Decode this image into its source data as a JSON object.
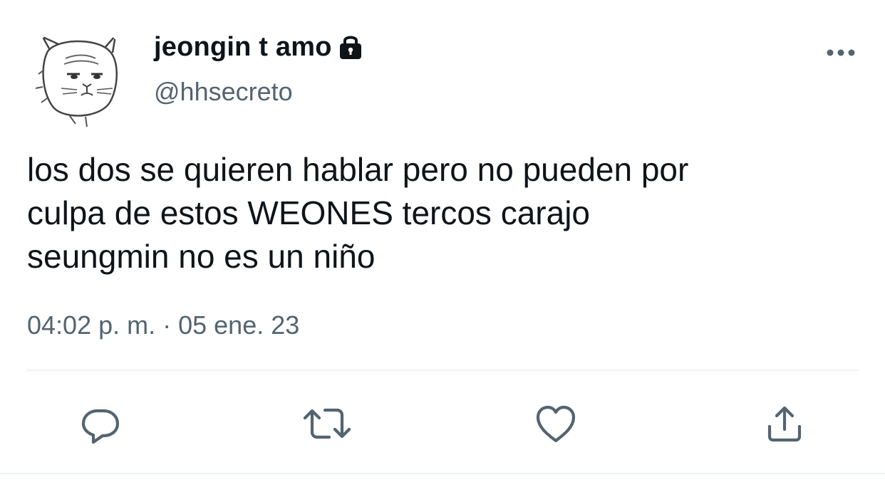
{
  "author": {
    "display_name": "jeongin t amo",
    "handle": "@hhsecreto",
    "protected_icon": "lock-icon",
    "avatar_icon": "cartoon-face-avatar"
  },
  "tweet": {
    "text": "los dos se quieren hablar pero no pueden por\nculpa de estos WEONES tercos carajo\nseungmin no es un niño",
    "time": "04:02 p. m.",
    "separator": " · ",
    "date": "05 ene. 23"
  },
  "header": {
    "more_icon": "more-horizontal-icon"
  },
  "actions": [
    {
      "name": "reply",
      "icon": "reply-bubble-icon"
    },
    {
      "name": "retweet",
      "icon": "retweet-icon"
    },
    {
      "name": "like",
      "icon": "heart-icon"
    },
    {
      "name": "share",
      "icon": "share-icon"
    }
  ],
  "colors": {
    "text": "#0f1419",
    "secondary": "#536471",
    "icon": "#536471",
    "divider": "#eff3f4",
    "background": "#ffffff"
  }
}
